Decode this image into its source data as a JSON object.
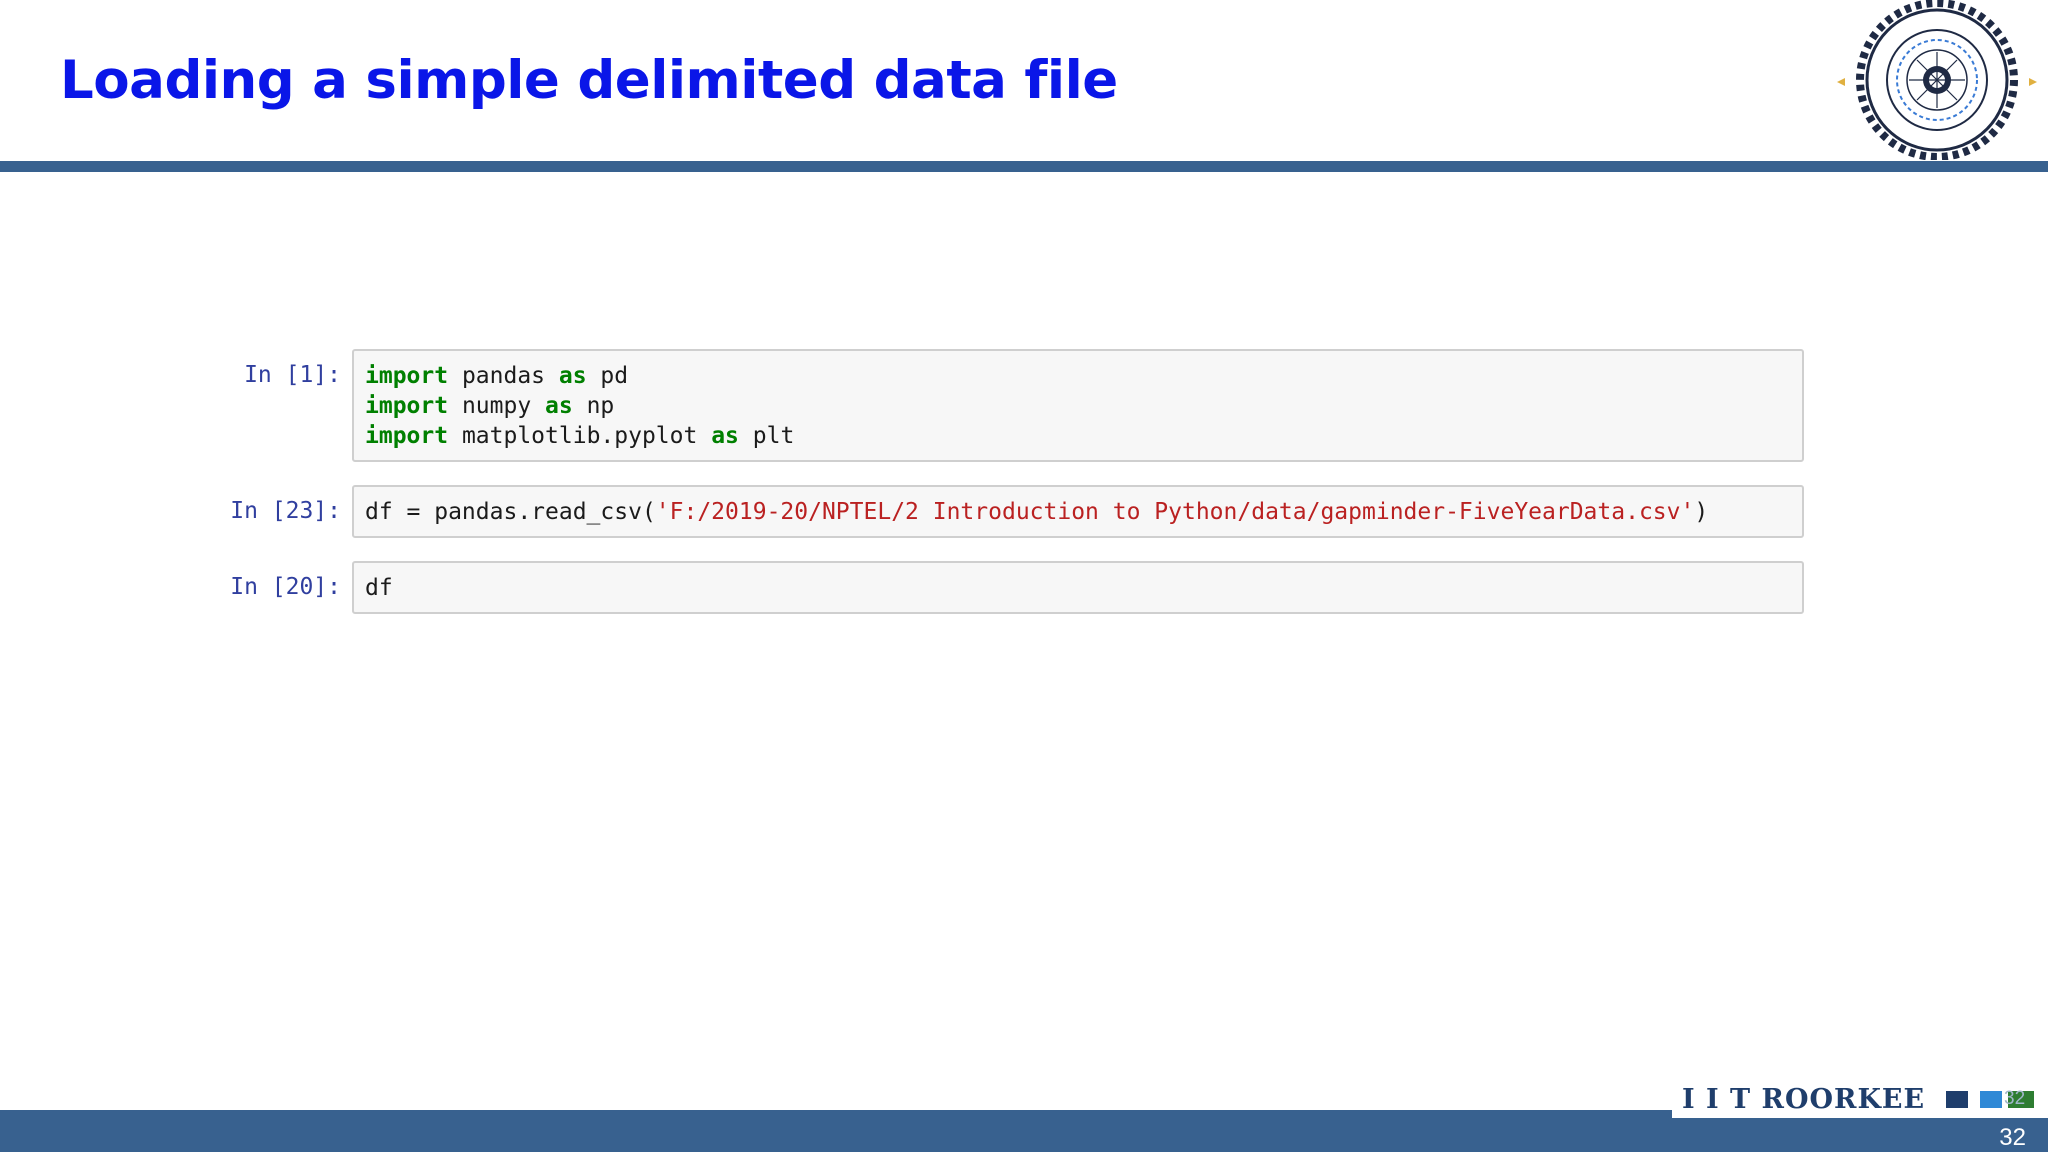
{
  "slide": {
    "title": "Loading a simple delimited data file",
    "page_number": "32",
    "page_number_small": "32"
  },
  "logo": {
    "icon": "iit-roorkee-seal-icon",
    "seal_text": "INDIAN INSTITUTE OF TECHNOLOGY ROORKEE"
  },
  "footer": {
    "brand": "I I T ROORKEE",
    "accent_colors": [
      "#1f3e6c",
      "#2f89d6",
      "#2e7d32"
    ]
  },
  "cells": [
    {
      "prompt": "In [1]:",
      "lines": [
        [
          {
            "t": "import",
            "k": "kw"
          },
          {
            "t": " pandas ",
            "k": ""
          },
          {
            "t": "as",
            "k": "kw"
          },
          {
            "t": " pd",
            "k": ""
          }
        ],
        [
          {
            "t": "import",
            "k": "kw"
          },
          {
            "t": " numpy ",
            "k": ""
          },
          {
            "t": "as",
            "k": "kw"
          },
          {
            "t": " np",
            "k": ""
          }
        ],
        [
          {
            "t": "import",
            "k": "kw"
          },
          {
            "t": " matplotlib.pyplot ",
            "k": ""
          },
          {
            "t": "as",
            "k": "kw"
          },
          {
            "t": " plt",
            "k": ""
          }
        ]
      ]
    },
    {
      "prompt": "In [23]:",
      "lines": [
        [
          {
            "t": "df = pandas.read_csv(",
            "k": ""
          },
          {
            "t": "'F:/2019-20/NPTEL/2 Introduction to Python/data/gapminder-FiveYearData.csv'",
            "k": "str"
          },
          {
            "t": ")",
            "k": ""
          }
        ]
      ]
    },
    {
      "prompt": "In [20]:",
      "lines": [
        [
          {
            "t": "df",
            "k": ""
          }
        ]
      ]
    }
  ],
  "colors": {
    "title": "#0a16e8",
    "rule": "#38618f",
    "prompt": "#303f9f",
    "keyword": "#008000",
    "string": "#ba2121"
  }
}
